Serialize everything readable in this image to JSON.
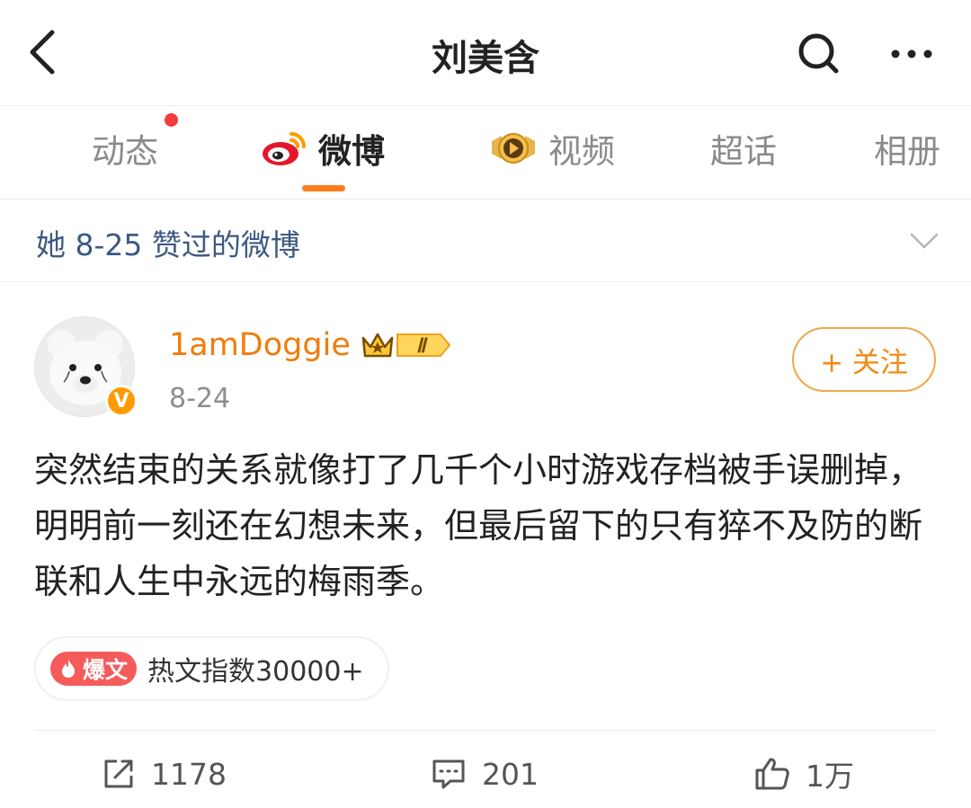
{
  "header": {
    "title": "刘美含",
    "back_icon": "chevron-left-icon",
    "search_icon": "search-icon",
    "more_icon": "more-icon"
  },
  "tabs": [
    {
      "label": "动态",
      "has_new": true
    },
    {
      "label": "微博",
      "active": true,
      "icon": "weibo-logo-icon"
    },
    {
      "label": "视频",
      "icon": "video-play-icon"
    },
    {
      "label": "超话"
    },
    {
      "label": "相册"
    }
  ],
  "filter": {
    "label": "她 8-25 赞过的微博",
    "icon": "chevron-down-icon"
  },
  "post": {
    "username": "1amDoggie",
    "vip_level": "Ⅱ",
    "verified_badge": "V",
    "date": "8-24",
    "follow_label": "+ 关注",
    "text": "突然结束的关系就像打了几千个小时游戏存档被手误删掉，明明前一刻还在幻想未来，但最后留下的只有猝不及防的断联和人生中永远的梅雨季。",
    "hot_tag": "爆文",
    "hot_text": "热文指数30000+",
    "actions": {
      "repost": "1178",
      "comment": "201",
      "like": "1万"
    }
  },
  "colors": {
    "accent": "#ff7d1a",
    "username": "#f27c0b",
    "follow": "#f08a14",
    "filter_text": "#3d5a80",
    "hot_tag": "#f55b5b",
    "notification_dot": "#f23d3d"
  }
}
